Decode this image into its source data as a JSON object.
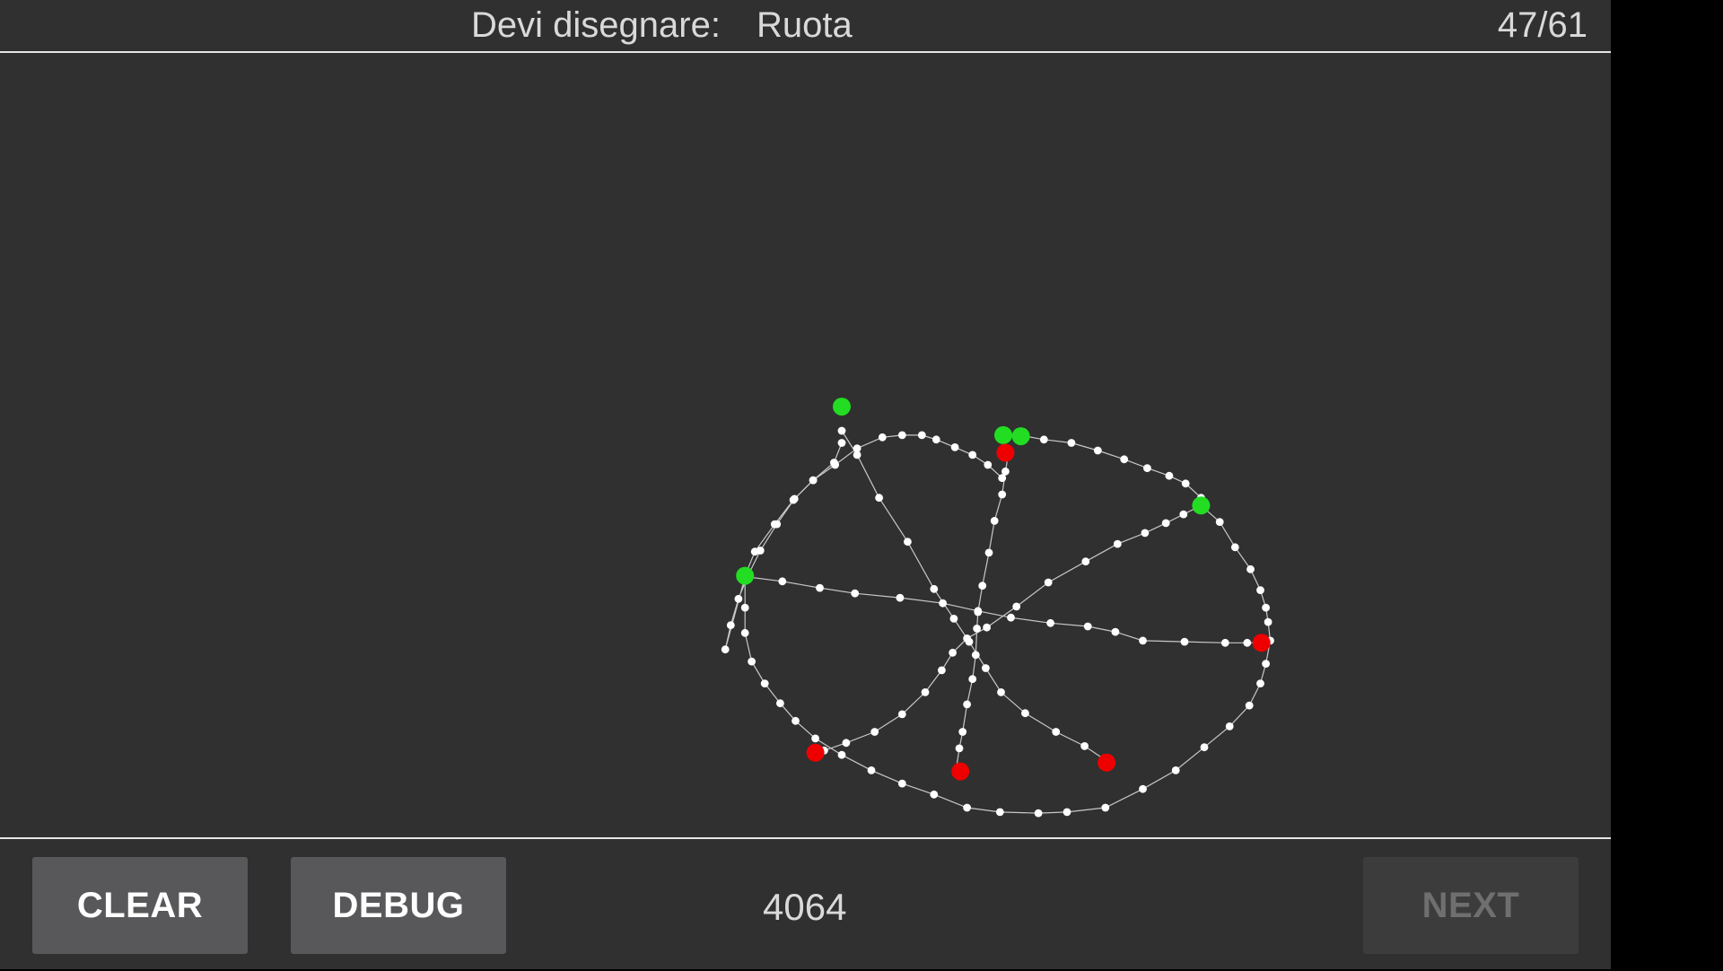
{
  "header": {
    "prompt_label": "Devi disegnare:",
    "prompt_word": "Ruota",
    "progress": "47/61"
  },
  "footer": {
    "clear_label": "CLEAR",
    "debug_label": "DEBUG",
    "score": "4064",
    "next_label": "NEXT"
  },
  "colors": {
    "background": "#303030",
    "stroke_point": "#ffffff",
    "start_point": "#22dd22",
    "end_point": "#ee0000"
  }
}
